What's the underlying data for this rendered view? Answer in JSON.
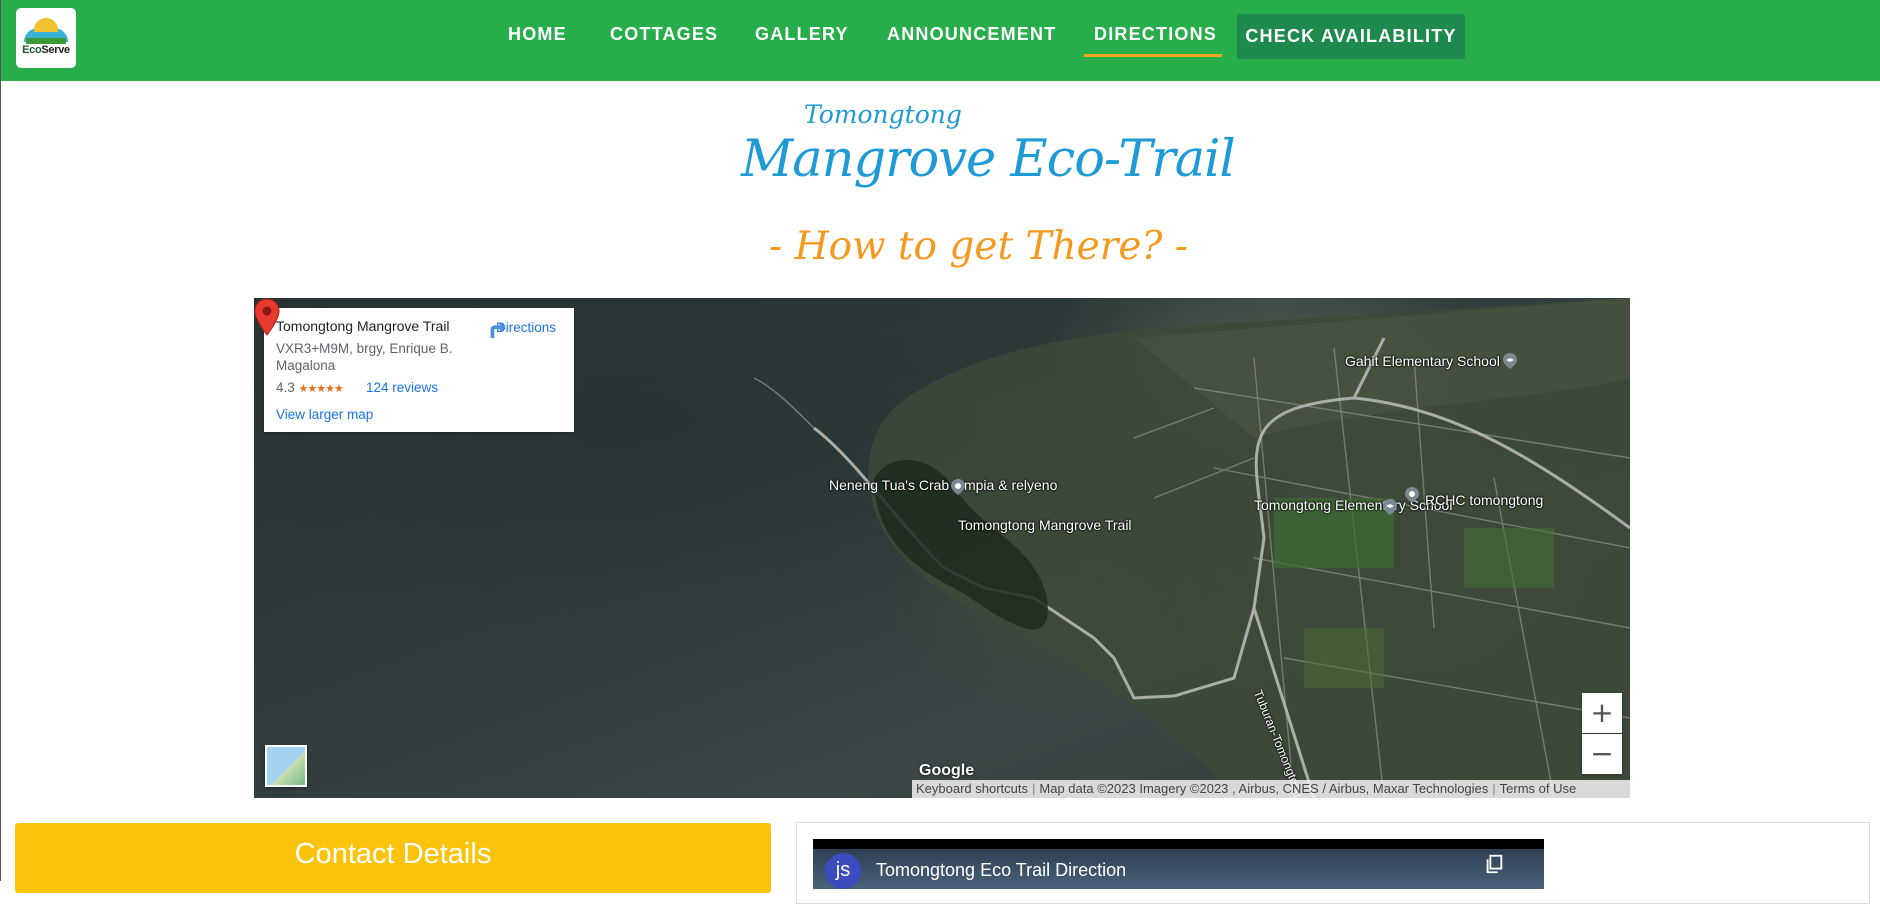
{
  "logo": {
    "text_part1": "Eco",
    "text_part2": "Serve"
  },
  "nav": {
    "items": [
      {
        "label": "HOME"
      },
      {
        "label": "COTTAGES"
      },
      {
        "label": "GALLERY"
      },
      {
        "label": "ANNOUNCEMENT"
      },
      {
        "label": "DIRECTIONS",
        "active": true
      }
    ],
    "cta_label": "CHECK AVAILABILITY",
    "colors": {
      "bar": "#27ae4b",
      "active_underline": "#f4a91c",
      "cta": "#1f8a4e"
    }
  },
  "hero": {
    "subtitle": "Tomongtong",
    "title": "Mangrove Eco-Trail",
    "tagline": "- How to get There? -"
  },
  "map": {
    "place_name": "Tomongtong Mangrove Trail",
    "address": "VXR3+M9M, brgy, Enrique B. Magalona",
    "rating": "4.3",
    "stars": "★★★★★",
    "reviews": "124 reviews",
    "view_larger": "View larger map",
    "directions": "Directions",
    "labels": {
      "gahit": "Gahit Elementary School",
      "neneng": "Neneng Tua's Crab lumpia & relyeno",
      "pin_label": "Tomongtong Mangrove Trail",
      "tomongtong_school": "Tomongtong Elementary School",
      "rchc": "RCHC tomongtong",
      "road": "Tuburan-Tomongtong"
    },
    "zoom_in": "+",
    "zoom_out": "−",
    "google": "Google",
    "attribution": {
      "shortcuts": "Keyboard shortcuts",
      "data": "Map data ©2023 Imagery ©2023 , Airbus, CNES / Airbus, Maxar Technologies",
      "terms": "Terms of Use"
    }
  },
  "contact": {
    "heading": "Contact Details",
    "color": "#fcc30b"
  },
  "video": {
    "channel_initials": "js",
    "title": "Tomongtong Eco Trail Direction"
  }
}
